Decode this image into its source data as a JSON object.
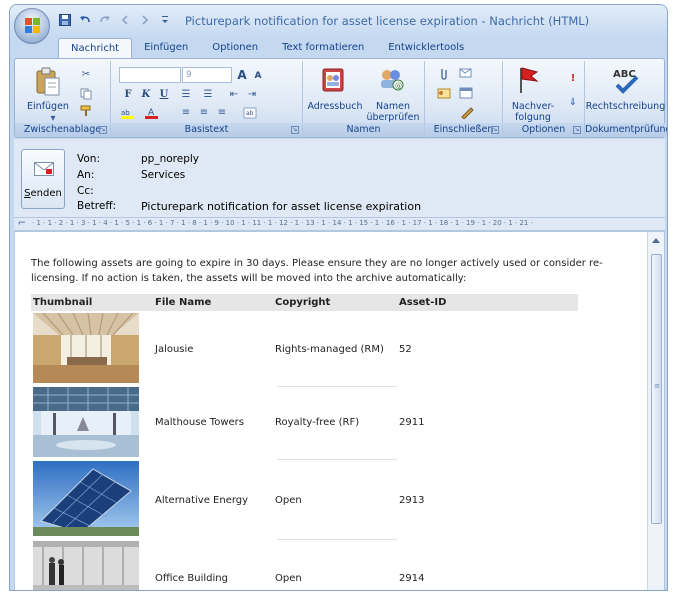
{
  "window": {
    "title": "Picturepark notification for asset license expiration - Nachricht (HTML)"
  },
  "tabs": [
    {
      "label": "Nachricht",
      "active": true
    },
    {
      "label": "Einfügen",
      "active": false
    },
    {
      "label": "Optionen",
      "active": false
    },
    {
      "label": "Text formatieren",
      "active": false
    },
    {
      "label": "Entwicklertools",
      "active": false
    }
  ],
  "ribbon": {
    "einfuegen_label": "Einfügen",
    "font_size": "9",
    "adressbuch_label": "Adressbuch",
    "namen_label_1": "Namen",
    "namen_label_2": "überprüfen",
    "nachver_label_1": "Nachver-",
    "nachver_label_2": "folgung",
    "rechtschreibung_label": "Rechtschreibung",
    "groups": [
      "Zwischenablage",
      "Basistext",
      "Namen",
      "Einschließen",
      "Optionen",
      "Dokumentprüfung"
    ],
    "format_buttons": [
      "F",
      "K",
      "U"
    ],
    "font_grow": "A",
    "font_shrink": "A"
  },
  "header": {
    "send_label": "Senden",
    "send_accesskey": "S",
    "labels": {
      "from": "Von:",
      "to": "An:",
      "cc": "Cc:",
      "subject": "Betreff:"
    },
    "values": {
      "from": "pp_noreply",
      "to": "Services",
      "cc": "",
      "subject": "Picturepark notification for asset license expiration"
    }
  },
  "ruler": {
    "text": "· 1 · 1 · 2 · 1 · 3 · 1 · 4 · 1 · 5 · 1 · 6 · 1 · 7 · 1 · 8 · 1 · 9 · 10 · 1 · 11 · 1 · 12 · 1 · 13 · 1 · 14 · 1 · 15 · 1 · 16 · 1 · 17 · 1 · 18 · 1 · 19 · 1 · 20 · 1 · 21 ·"
  },
  "body": {
    "intro": "The following assets are going to expire in 30 days. Please ensure they are no longer actively used or consider re-licensing. If no action is taken, the assets will be moved into the archive automatically:",
    "columns": [
      "Thumbnail",
      "File Name",
      "Copyright",
      "Asset-ID"
    ],
    "rows": [
      {
        "file_name": "Jalousie",
        "copyright": "Rights-managed (RM)",
        "asset_id": "52",
        "thumb": "interior-room"
      },
      {
        "file_name": "Malthouse Towers",
        "copyright": "Royalty-free (RF)",
        "asset_id": "2911",
        "thumb": "atrium-lobby"
      },
      {
        "file_name": "Alternative Energy",
        "copyright": "Open",
        "asset_id": "2913",
        "thumb": "solar-panels"
      },
      {
        "file_name": "Office Building",
        "copyright": "Open",
        "asset_id": "2914",
        "thumb": "office-people"
      }
    ]
  },
  "colors": {
    "ribbon_text": "#15428b",
    "frame": "#c4d8f0",
    "table_header_bg": "#e6e6e6"
  }
}
